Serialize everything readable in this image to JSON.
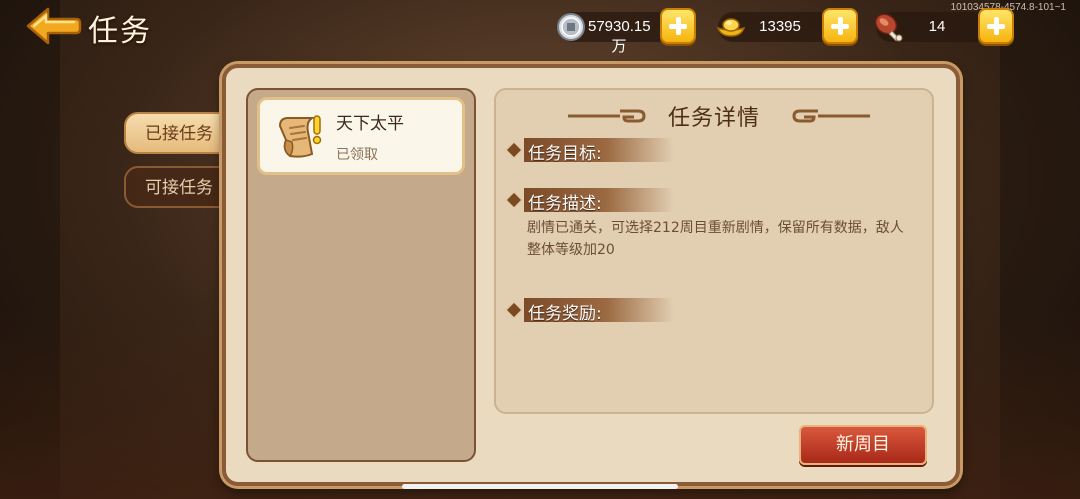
{
  "header": {
    "title": "任务",
    "build_id": "101034578-4574.8-101~1"
  },
  "resources": [
    {
      "icon": "silver-coin-icon",
      "value": "57930.15万"
    },
    {
      "icon": "gold-ingot-icon",
      "value": "13395"
    },
    {
      "icon": "meat-drumstick-icon",
      "value": "14"
    }
  ],
  "tabs": [
    {
      "label": "已接任务",
      "active": true
    },
    {
      "label": "可接任务",
      "active": false
    }
  ],
  "task_list": [
    {
      "name": "天下太平",
      "status": "已领取",
      "icon": "scroll-exclamation-icon"
    }
  ],
  "detail": {
    "title": "任务详情",
    "goal_label": "任务目标:",
    "desc_label": "任务描述:",
    "desc_text": "剧情已通关，可选择212周目重新剧情，保留所有数据，敌人整体等级加20",
    "reward_label": "任务奖励:"
  },
  "actions": {
    "new_cycle_label": "新周目"
  },
  "colors": {
    "panel": "#eadbc0",
    "frame": "#8b5a36",
    "button_red": "#c23a25",
    "plus_yellow": "#f7b40e"
  }
}
